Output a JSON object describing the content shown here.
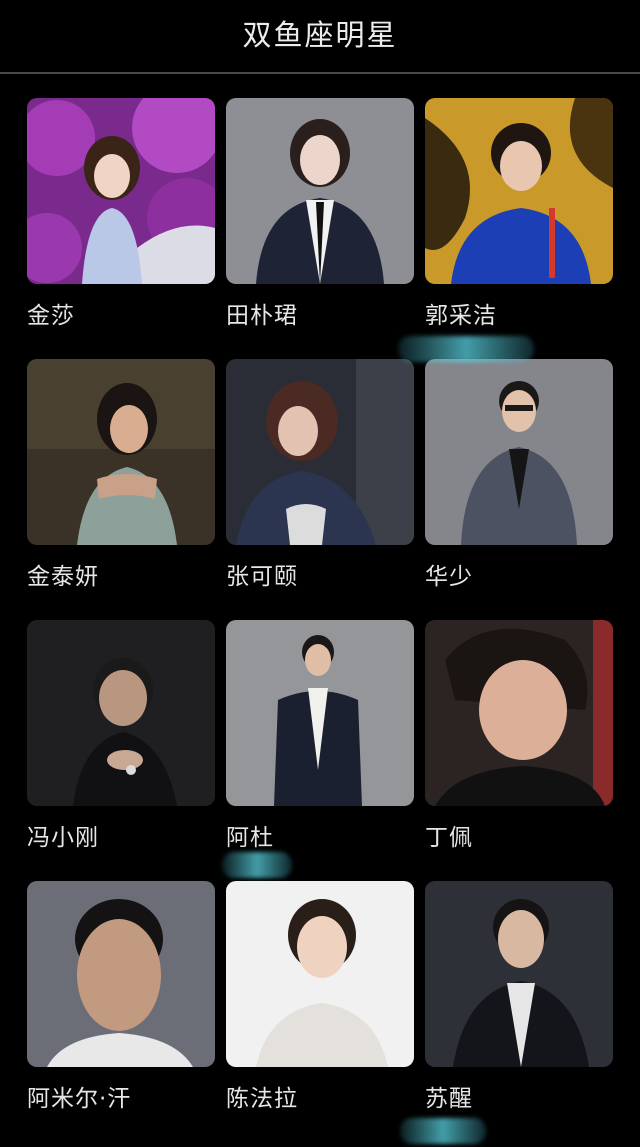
{
  "header": {
    "title": "双鱼座明星"
  },
  "stars": [
    {
      "name": "金莎",
      "icon": "person-photo-icon"
    },
    {
      "name": "田朴珺",
      "icon": "person-photo-icon"
    },
    {
      "name": "郭采洁",
      "icon": "person-photo-icon"
    },
    {
      "name": "金泰妍",
      "icon": "person-photo-icon"
    },
    {
      "name": "张可颐",
      "icon": "person-photo-icon"
    },
    {
      "name": "华少",
      "icon": "person-photo-icon"
    },
    {
      "name": "冯小刚",
      "icon": "person-photo-icon"
    },
    {
      "name": "阿杜",
      "icon": "person-photo-icon"
    },
    {
      "name": "丁佩",
      "icon": "person-photo-icon"
    },
    {
      "name": "阿米尔·汗",
      "icon": "person-photo-icon"
    },
    {
      "name": "陈法拉",
      "icon": "person-photo-icon"
    },
    {
      "name": "苏醒",
      "icon": "person-photo-icon"
    }
  ],
  "colors": {
    "background": "#000000",
    "text": "#e6e6e6",
    "divider": "#4a4a4a",
    "smudge": "#5ccbd9"
  }
}
